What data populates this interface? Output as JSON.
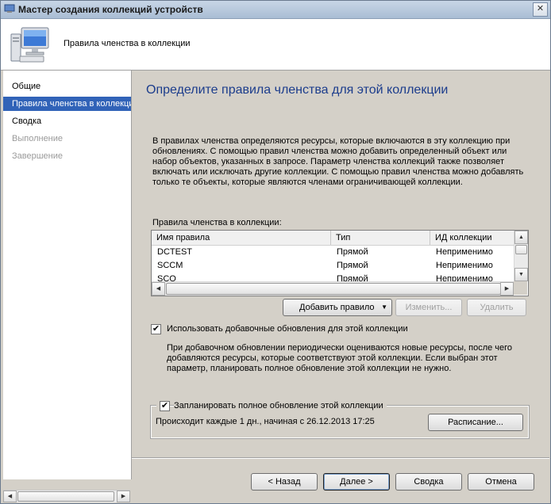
{
  "window": {
    "title": "Мастер создания коллекций устройств",
    "close_glyph": "✕"
  },
  "header": {
    "subtitle": "Правила членства в коллекции",
    "icon": "computer-icon"
  },
  "nav": {
    "items": [
      {
        "label": "Общие",
        "state": "normal"
      },
      {
        "label": "Правила членства в коллекции",
        "state": "active"
      },
      {
        "label": "Сводка",
        "state": "normal"
      },
      {
        "label": "Выполнение",
        "state": "disabled"
      },
      {
        "label": "Завершение",
        "state": "disabled"
      }
    ]
  },
  "main": {
    "title": "Определите правила членства для этой коллекции",
    "description_lines": [
      "В правилах членства определяются ресурсы, которые включаются в эту коллекцию при",
      "обновлениях. С помощью правил членства можно добавить определенный объект или",
      "набор объектов, указанных в запросе. Параметр членства коллекций также позволяет",
      "включать или исключать другие коллекции. С помощью правил членства можно добавлять",
      "только те объекты, которые являются членами ограничивающей коллекции."
    ],
    "list_label": "Правила членства в коллекции:",
    "table": {
      "columns": [
        "Имя правила",
        "Тип",
        "ИД коллекции"
      ],
      "rows": [
        [
          "DCTEST",
          "Прямой",
          "Неприменимо"
        ],
        [
          "SCCM",
          "Прямой",
          "Неприменимо"
        ],
        [
          "SCO",
          "Прямой",
          "Неприменимо"
        ]
      ]
    },
    "buttons": {
      "add_rule": "Добавить правило",
      "edit": "Изменить...",
      "delete": "Удалить"
    },
    "incremental": {
      "checked": true,
      "label": "Использовать добавочные обновления для этой коллекции",
      "help_lines": [
        "При добавочном обновлении периодически оцениваются новые ресурсы, после чего",
        "добавляются ресурсы, которые соответствуют этой коллекции. Если выбран этот",
        "параметр, планировать полное обновление этой коллекции не нужно."
      ]
    },
    "full_update": {
      "checked": true,
      "label": "Запланировать полное обновление этой коллекции",
      "schedule_text": "Происходит каждые 1 дн., начиная с 26.12.2013 17:25",
      "schedule_button": "Расписание..."
    }
  },
  "footer": {
    "back": "< Назад",
    "next": "Далее >",
    "summary": "Сводка",
    "cancel": "Отмена"
  }
}
